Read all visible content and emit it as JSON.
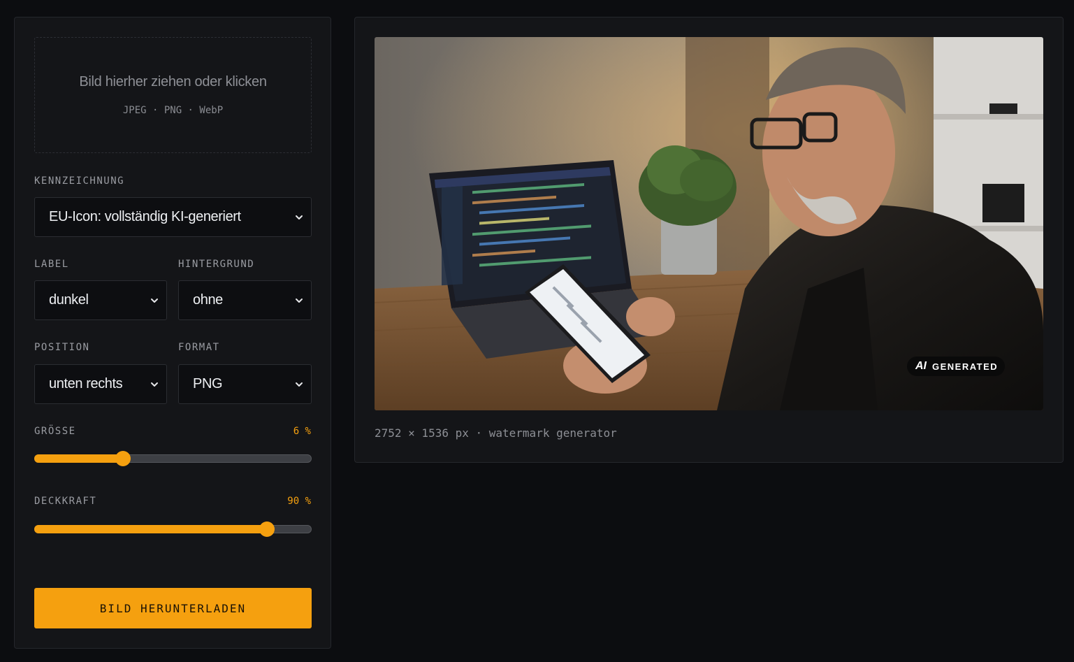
{
  "upload": {
    "title": "Bild hierher ziehen oder klicken",
    "formats": "JPEG · PNG · WebP"
  },
  "labeling": {
    "label": "KENNZEICHNUNG",
    "selected": "EU-Icon: vollständig KI-generiert"
  },
  "label_select": {
    "label": "LABEL",
    "selected": "dunkel"
  },
  "background_select": {
    "label": "HINTERGRUND",
    "selected": "ohne"
  },
  "position_select": {
    "label": "POSITION",
    "selected": "unten rechts"
  },
  "format_select": {
    "label": "FORMAT",
    "selected": "PNG"
  },
  "size_slider": {
    "label": "GRÖSSE",
    "value_text": "6 %",
    "fraction": 0.32
  },
  "opacity_slider": {
    "label": "DECKKRAFT",
    "value_text": "90 %",
    "fraction": 0.84
  },
  "download": {
    "label": "BILD HERUNTERLADEN"
  },
  "preview": {
    "caption": "2752 × 1536 px · watermark generator",
    "badge_ai": "AI",
    "badge_text": "GENERATED"
  },
  "colors": {
    "accent": "#f5a00f",
    "background": "#0c0d10",
    "panel": "#141518"
  },
  "icons": {
    "select_chevron": "chevron-down-icon"
  }
}
